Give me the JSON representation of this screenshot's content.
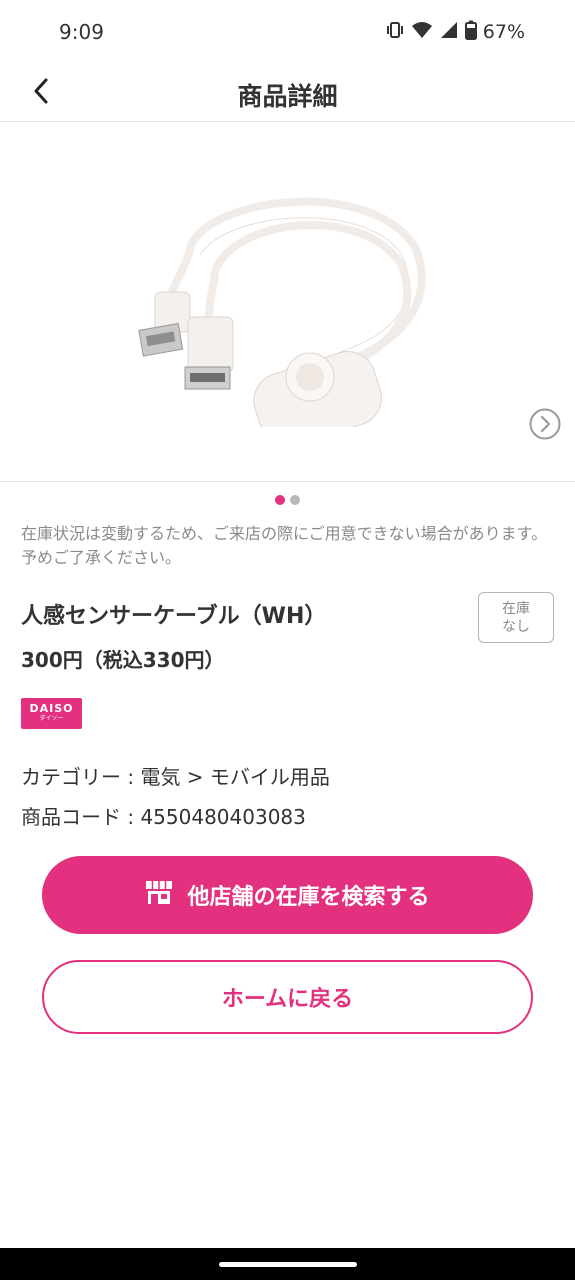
{
  "status_bar": {
    "time": "9:09",
    "battery_percent": "67%",
    "icons": [
      "vibrate-icon",
      "wifi-icon",
      "signal-icon",
      "battery-icon"
    ]
  },
  "app_bar": {
    "title": "商品詳細",
    "back_icon": "chevron-left-icon"
  },
  "gallery": {
    "image_alt": "USB cable with motion sensor",
    "page_count": 2,
    "current_page": 1,
    "next_icon": "chevron-right-circle-icon"
  },
  "notice": "在庫状況は変動するため、ご来店の際にご用意できない場合があります。予めご了承ください。",
  "product": {
    "name": "人感センサーケーブル（WH）",
    "price": "300円（税込330円）",
    "stock_badge": {
      "line1": "在庫",
      "line2": "なし"
    },
    "brand": {
      "main": "DAISO",
      "sub": "ダイソー"
    },
    "category": "カテゴリー : 電気 > モバイル用品",
    "code": "商品コード : 4550480403083"
  },
  "actions": {
    "search_label": "他店舗の在庫を検索する",
    "search_icon": "store-icon",
    "home_label": "ホームに戻る"
  },
  "colors": {
    "accent": "#e3307f",
    "text": "#333333",
    "muted": "#8a8a8a"
  }
}
